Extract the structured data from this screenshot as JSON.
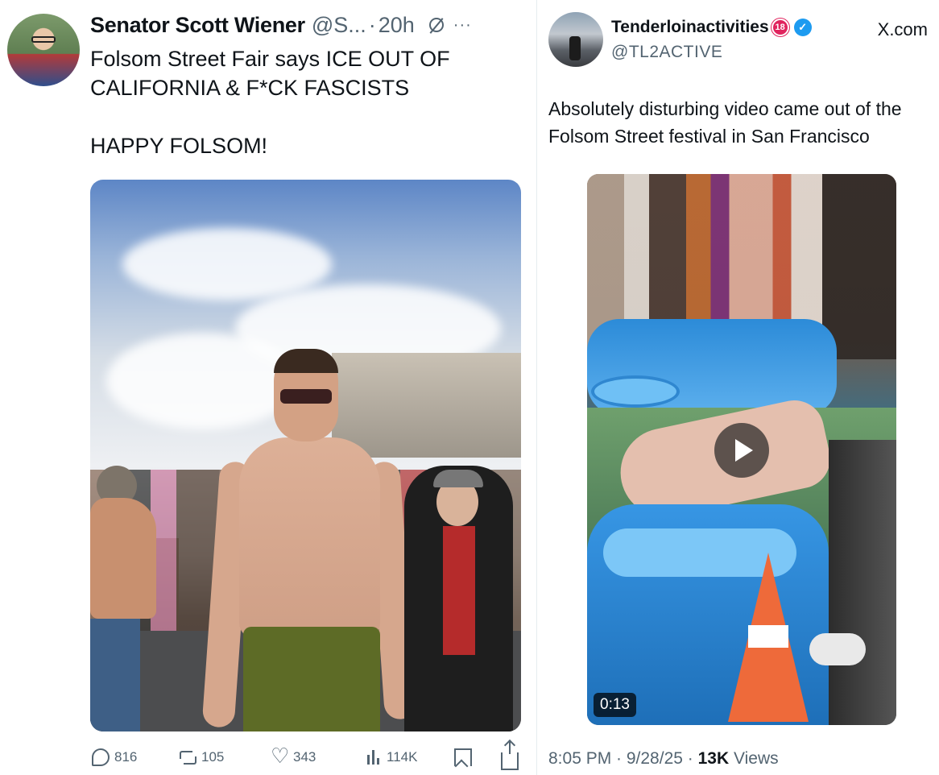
{
  "left_tweet": {
    "author_name": "Senator Scott Wiener",
    "handle": "@S...",
    "dot": "·",
    "time": "20h",
    "text_line1": "Folsom Street Fair says ICE OUT OF",
    "text_line2": "CALIFORNIA & F*CK FASCISTS",
    "text_line3": "HAPPY FOLSOM!",
    "stats": {
      "replies": "816",
      "reposts": "105",
      "likes": "343",
      "views": "114K"
    },
    "icons": [
      "grok-icon",
      "more-icon",
      "reply-icon",
      "retweet-icon",
      "heart-icon",
      "views-icon",
      "bookmark-icon",
      "share-icon"
    ]
  },
  "right_tweet": {
    "author_name": "Tenderloinactivities",
    "age_badge": "18",
    "handle": "@TL2ACTIVE",
    "source_label": "X.com",
    "text": "Absolutely disturbing video came out of the Folsom Street festival in San Francisco",
    "video_duration": "0:13",
    "timestamp": "8:05 PM · 9/28/25 · ",
    "views_count": "13K",
    "views_label": " Views",
    "icons": [
      "age-badge-icon",
      "verified-icon",
      "play-icon"
    ]
  },
  "colors": {
    "text_primary": "#0f1419",
    "text_secondary": "#536471",
    "verified_blue": "#1d9bf0",
    "age_badge_red": "#e0245e"
  }
}
